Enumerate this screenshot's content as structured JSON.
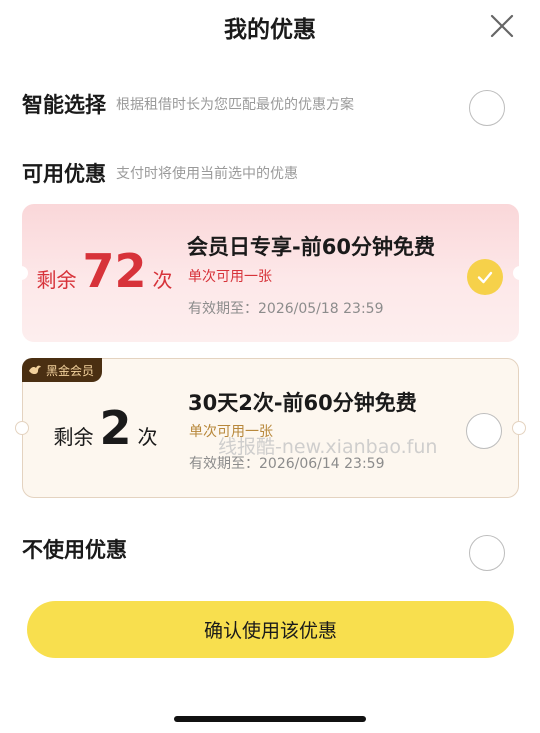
{
  "header": {
    "title": "我的优惠"
  },
  "smart_select": {
    "title": "智能选择",
    "desc": "根据租借时长为您匹配最优的优惠方案"
  },
  "available": {
    "title": "可用优惠",
    "desc": "支付时将使用当前选中的优惠"
  },
  "coupons": [
    {
      "count_prefix": "剩余",
      "count": "72",
      "count_suffix": "次",
      "title": "会员日专享-前60分钟免费",
      "rule": "单次可用一张",
      "expiry": "有效期至：2026/05/18  23:59",
      "selected": true
    },
    {
      "badge": "黑金会员",
      "count_prefix": "剩余",
      "count": "2",
      "count_suffix": "次",
      "title": "30天2次-前60分钟免费",
      "rule": "单次可用一张",
      "expiry": "有效期至：2026/06/14  23:59",
      "selected": false
    }
  ],
  "no_coupon": {
    "title": "不使用优惠"
  },
  "confirm": {
    "label": "确认使用该优惠"
  },
  "watermark": "线报酷-new.xianbao.fun",
  "colors": {
    "accent_yellow": "#f8df4e",
    "accent_red": "#d7333a",
    "badge_bg": "#4a2f12"
  }
}
